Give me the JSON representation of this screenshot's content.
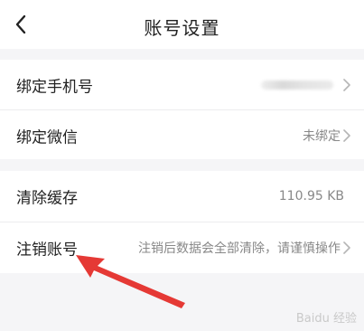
{
  "header": {
    "title": "账号设置"
  },
  "account_group": {
    "bind_phone": {
      "label": "绑定手机号",
      "value": ""
    },
    "bind_wechat": {
      "label": "绑定微信",
      "value": "未绑定"
    }
  },
  "storage_group": {
    "clear_cache": {
      "label": "清除缓存",
      "value": "110.95 KB"
    },
    "delete_account": {
      "label": "注销账号",
      "hint": "注销后数据会全部清除，请谨慎操作"
    }
  },
  "watermark": {
    "text": "Baidu 经验"
  },
  "colors": {
    "accent": "#b4237e",
    "arrow": "#e53935",
    "background": "#f5f5f7"
  }
}
